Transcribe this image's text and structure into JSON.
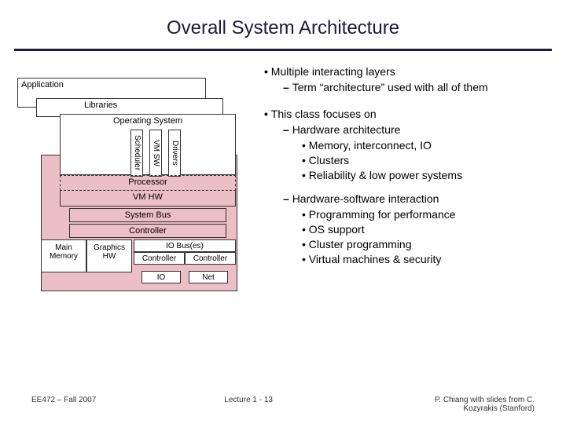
{
  "title": "Overall System Architecture",
  "bullets": {
    "l1a": "Multiple interacting layers",
    "l2a": "Term “architecture” used with all of them",
    "l1b": "This class focuses on",
    "l2b": "Hardware architecture",
    "l3b1": "Memory, interconnect, IO",
    "l3b2": "Clusters",
    "l3b3": "Reliability & low power systems",
    "l2c": "Hardware-software interaction",
    "l3c1": "Programming for performance",
    "l3c2": "OS support",
    "l3c3": "Cluster programming",
    "l3c4": "Virtual machines & security"
  },
  "diagram": {
    "application": "Application",
    "libraries": "Libraries",
    "os": "Operating System",
    "scheduler": "Scheduler",
    "vmsw": "VM SW",
    "drivers": "Drivers",
    "processor": "Processor",
    "vmhw": "VM HW",
    "sysbus": "System Bus",
    "controller": "Controller",
    "mainmem": "Main Memory",
    "graphics": "Graphics HW",
    "iobuses": "IO Bus(es)",
    "io": "IO",
    "net": "Net"
  },
  "footer": {
    "left": "EE472 – Fall 2007",
    "mid": "Lecture 1 - 13",
    "right": "P. Chiang with slides from C. Kozyrakis (Stanford)"
  }
}
